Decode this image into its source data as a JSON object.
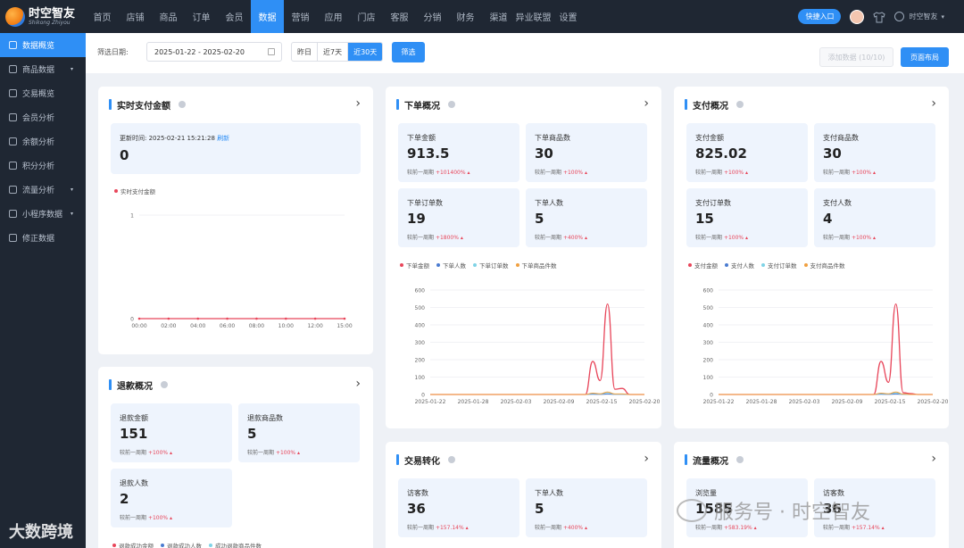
{
  "topbar": {
    "logo_title": "时空智友",
    "logo_sub": "Shikong Zhiyou",
    "nav": [
      "首页",
      "店铺",
      "商品",
      "订单",
      "会员",
      "数据",
      "营销",
      "应用",
      "门店",
      "客服",
      "分销",
      "财务",
      "渠道",
      "异业联盟",
      "设置"
    ],
    "active_nav": "数据",
    "quick_entry": "快捷入口",
    "username": "时空智友"
  },
  "sidebar": {
    "items": [
      {
        "label": "数据概览",
        "active": true
      },
      {
        "label": "商品数据",
        "arrow": "▾"
      },
      {
        "label": "交易概览"
      },
      {
        "label": "会员分析"
      },
      {
        "label": "余额分析"
      },
      {
        "label": "积分分析"
      },
      {
        "label": "流量分析",
        "arrow": "▾"
      },
      {
        "label": "小程序数据",
        "arrow": "▾"
      },
      {
        "label": "修正数据"
      }
    ]
  },
  "filter": {
    "label": "筛选日期:",
    "date_range": "2025-01-22 - 2025-02-20",
    "ranges": [
      "昨日",
      "近7天",
      "近30天"
    ],
    "active_range": "近30天",
    "filter_btn": "筛选",
    "add_data": "添加数据 (10/10)",
    "layout_btn": "页面布局"
  },
  "colors": {
    "accent": "#2f8ff5",
    "red": "#e8465a",
    "blue": "#4a7bd0",
    "cyan": "#7fd3e6",
    "orange": "#f0a040"
  },
  "realtime": {
    "title": "实时支付金额",
    "update_label": "更新时间:",
    "update_time": "2025-02-21 15:21:28",
    "refresh": "刷新",
    "value": "0",
    "legend": "实时支付金额"
  },
  "orders": {
    "title": "下单概况",
    "stats": [
      {
        "label": "下单金额",
        "value": "913.5",
        "cmp": "较前一周期",
        "pct": "+101400% ▴"
      },
      {
        "label": "下单商品数",
        "value": "30",
        "cmp": "较前一周期",
        "pct": "+100% ▴"
      },
      {
        "label": "下单订单数",
        "value": "19",
        "cmp": "较前一周期",
        "pct": "+1800% ▴"
      },
      {
        "label": "下单人数",
        "value": "5",
        "cmp": "较前一周期",
        "pct": "+400% ▴"
      }
    ],
    "legend": [
      "下单金额",
      "下单人数",
      "下单订单数",
      "下单商品件数"
    ]
  },
  "payment": {
    "title": "支付概况",
    "stats": [
      {
        "label": "支付金额",
        "value": "825.02",
        "cmp": "较前一周期",
        "pct": "+100% ▴"
      },
      {
        "label": "支付商品数",
        "value": "30",
        "cmp": "较前一周期",
        "pct": "+100% ▴"
      },
      {
        "label": "支付订单数",
        "value": "15",
        "cmp": "较前一周期",
        "pct": "+100% ▴"
      },
      {
        "label": "支付人数",
        "value": "4",
        "cmp": "较前一周期",
        "pct": "+100% ▴"
      }
    ],
    "legend": [
      "支付金额",
      "支付人数",
      "支付订单数",
      "支付商品件数"
    ]
  },
  "refund": {
    "title": "退款概况",
    "stats": [
      {
        "label": "退款金额",
        "value": "151",
        "cmp": "较前一周期",
        "pct": "+100% ▴"
      },
      {
        "label": "退款商品数",
        "value": "5",
        "cmp": "较前一周期",
        "pct": "+100% ▴"
      },
      {
        "label": "退款人数",
        "value": "2",
        "cmp": "较前一周期",
        "pct": "+100% ▴"
      }
    ],
    "legend": [
      "退款成功金额",
      "退款成功人数",
      "成功退款商品件数"
    ]
  },
  "conversion": {
    "title": "交易转化",
    "stats": [
      {
        "label": "访客数",
        "value": "36",
        "cmp": "较前一周期",
        "pct": "+157.14% ▴"
      },
      {
        "label": "下单人数",
        "value": "5",
        "cmp": "较前一周期",
        "pct": "+400% ▴"
      }
    ]
  },
  "traffic": {
    "title": "流量概况",
    "stats": [
      {
        "label": "浏览量",
        "value": "1585",
        "cmp": "较前一周期",
        "pct": "+583.19% ▴"
      },
      {
        "label": "访客数",
        "value": "36",
        "cmp": "较前一周期",
        "pct": "+157.14% ▴"
      }
    ]
  },
  "watermark": {
    "text": "服务号 · 时空智友",
    "corner": "大数跨境"
  },
  "chart_data": [
    {
      "type": "line",
      "title": "实时支付金额",
      "x": [
        "00:00",
        "02:00",
        "04:00",
        "06:00",
        "08:00",
        "10:00",
        "12:00",
        "15:00"
      ],
      "series": [
        {
          "name": "实时支付金额",
          "values": [
            0,
            0,
            0,
            0,
            0,
            0,
            0,
            0
          ]
        }
      ],
      "ylim": [
        0,
        1
      ],
      "yticks": [
        0,
        1
      ]
    },
    {
      "type": "line",
      "title": "下单概况",
      "x": [
        "2025-01-22",
        "2025-01-28",
        "2025-02-03",
        "2025-02-09",
        "2025-02-15",
        "2025-02-20"
      ],
      "ylim": [
        0,
        600
      ],
      "yticks": [
        0,
        100,
        200,
        300,
        400,
        500,
        600
      ],
      "series": [
        {
          "name": "下单金额",
          "values": [
            0,
            0,
            0,
            0,
            0,
            0,
            0,
            0,
            0,
            0,
            0,
            0,
            0,
            0,
            0,
            0,
            0,
            0,
            0,
            0,
            0,
            0,
            190,
            80,
            520,
            30,
            35,
            0,
            0,
            0
          ]
        },
        {
          "name": "下单人数",
          "values": [
            0,
            0,
            0,
            0,
            0,
            0,
            0,
            0,
            0,
            0,
            0,
            0,
            0,
            0,
            0,
            0,
            0,
            0,
            0,
            0,
            0,
            0,
            2,
            1,
            3,
            1,
            1,
            0,
            0,
            0
          ]
        },
        {
          "name": "下单订单数",
          "values": [
            0,
            0,
            0,
            0,
            0,
            0,
            0,
            0,
            0,
            0,
            0,
            0,
            0,
            0,
            0,
            0,
            0,
            0,
            0,
            0,
            0,
            0,
            6,
            3,
            10,
            2,
            2,
            0,
            0,
            0
          ]
        },
        {
          "name": "下单商品件数",
          "values": [
            0,
            0,
            0,
            0,
            0,
            0,
            0,
            0,
            0,
            0,
            0,
            0,
            0,
            0,
            0,
            0,
            0,
            0,
            0,
            0,
            0,
            0,
            8,
            4,
            14,
            3,
            3,
            0,
            0,
            0
          ]
        }
      ]
    },
    {
      "type": "line",
      "title": "支付概况",
      "x": [
        "2025-01-22",
        "2025-01-28",
        "2025-02-03",
        "2025-02-09",
        "2025-02-15",
        "2025-02-20"
      ],
      "ylim": [
        0,
        600
      ],
      "yticks": [
        0,
        100,
        200,
        300,
        400,
        500,
        600
      ],
      "series": [
        {
          "name": "支付金额",
          "values": [
            0,
            0,
            0,
            0,
            0,
            0,
            0,
            0,
            0,
            0,
            0,
            0,
            0,
            0,
            0,
            0,
            0,
            0,
            0,
            0,
            0,
            0,
            190,
            70,
            520,
            10,
            5,
            0,
            0,
            0
          ]
        },
        {
          "name": "支付人数",
          "values": [
            0,
            0,
            0,
            0,
            0,
            0,
            0,
            0,
            0,
            0,
            0,
            0,
            0,
            0,
            0,
            0,
            0,
            0,
            0,
            0,
            0,
            0,
            2,
            1,
            3,
            1,
            0,
            0,
            0,
            0
          ]
        },
        {
          "name": "支付订单数",
          "values": [
            0,
            0,
            0,
            0,
            0,
            0,
            0,
            0,
            0,
            0,
            0,
            0,
            0,
            0,
            0,
            0,
            0,
            0,
            0,
            0,
            0,
            0,
            5,
            3,
            9,
            1,
            0,
            0,
            0,
            0
          ]
        },
        {
          "name": "支付商品件数",
          "values": [
            0,
            0,
            0,
            0,
            0,
            0,
            0,
            0,
            0,
            0,
            0,
            0,
            0,
            0,
            0,
            0,
            0,
            0,
            0,
            0,
            0,
            0,
            8,
            4,
            14,
            2,
            0,
            0,
            0,
            0
          ]
        }
      ]
    }
  ]
}
